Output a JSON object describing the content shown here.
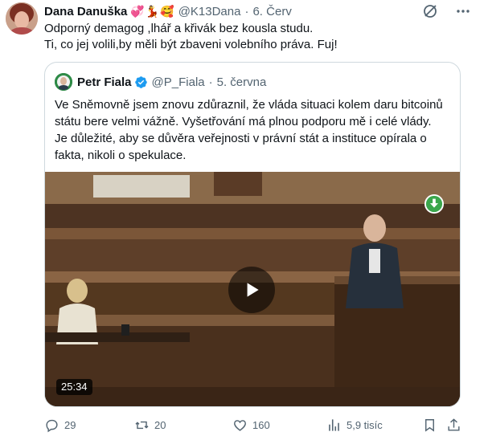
{
  "tweet": {
    "author": {
      "display_name": "Dana Danuška",
      "emojis": [
        "💞",
        "💃",
        "🥰"
      ],
      "handle": "@K13Dana",
      "separator": "·",
      "date": "6. Červ"
    },
    "text_lines": [
      "Odporný demagog ,lhář a křivák bez kousla studu.",
      "Ti, co jej volili,by měli být zbaveni volebního práva. Fuj!"
    ],
    "icons": {
      "grok": "grok-icon",
      "more": "more-icon"
    }
  },
  "quote": {
    "author": {
      "display_name": "Petr Fiala",
      "verified": "verified-badge-icon",
      "handle": "@P_Fiala",
      "separator": "·",
      "date": "5. června"
    },
    "text_lines": [
      "Ve Sněmovně jsem znovu zdůraznil, že vláda situaci kolem daru bitcoinů",
      "státu bere velmi vážně. Vyšetřování má plnou podporu mě i celé vlády.",
      "Je důležité, aby se důvěra veřejnosti v právní stát a instituce opírala o",
      "fakta, nikoli o spekulace."
    ],
    "video": {
      "duration": "25:34",
      "play_icon": "play-icon",
      "download_icon": "download-icon"
    }
  },
  "actions": {
    "replies": "29",
    "retweets": "20",
    "likes": "160",
    "views": "5,9 tisíc"
  },
  "colors": {
    "text_primary": "#0f1419",
    "text_secondary": "#536471",
    "border": "#cfd9de",
    "verified_blue": "#1d9bf0",
    "download_green": "#3aa64b"
  }
}
